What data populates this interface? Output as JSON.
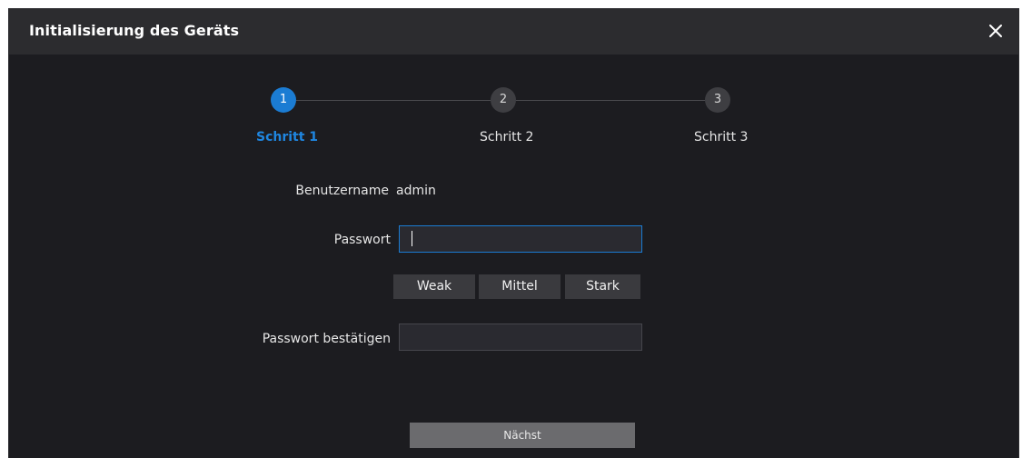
{
  "dialog": {
    "title": "Initialisierung des Geräts",
    "close_icon": "close-icon"
  },
  "stepper": {
    "steps": [
      {
        "number": "1",
        "label": "Schritt 1",
        "active": true
      },
      {
        "number": "2",
        "label": "Schritt 2",
        "active": false
      },
      {
        "number": "3",
        "label": "Schritt 3",
        "active": false
      }
    ]
  },
  "form": {
    "username_label": "Benutzername",
    "username_value": "admin",
    "password_label": "Passwort",
    "password_value": "",
    "strength": [
      "Weak",
      "Mittel",
      "Stark"
    ],
    "confirm_label": "Passwort bestätigen",
    "confirm_value": ""
  },
  "actions": {
    "next_label": "Nächst"
  },
  "colors": {
    "accent": "#1b7cd3",
    "background": "#1c1c20",
    "titlebar": "#2c2c2f"
  }
}
